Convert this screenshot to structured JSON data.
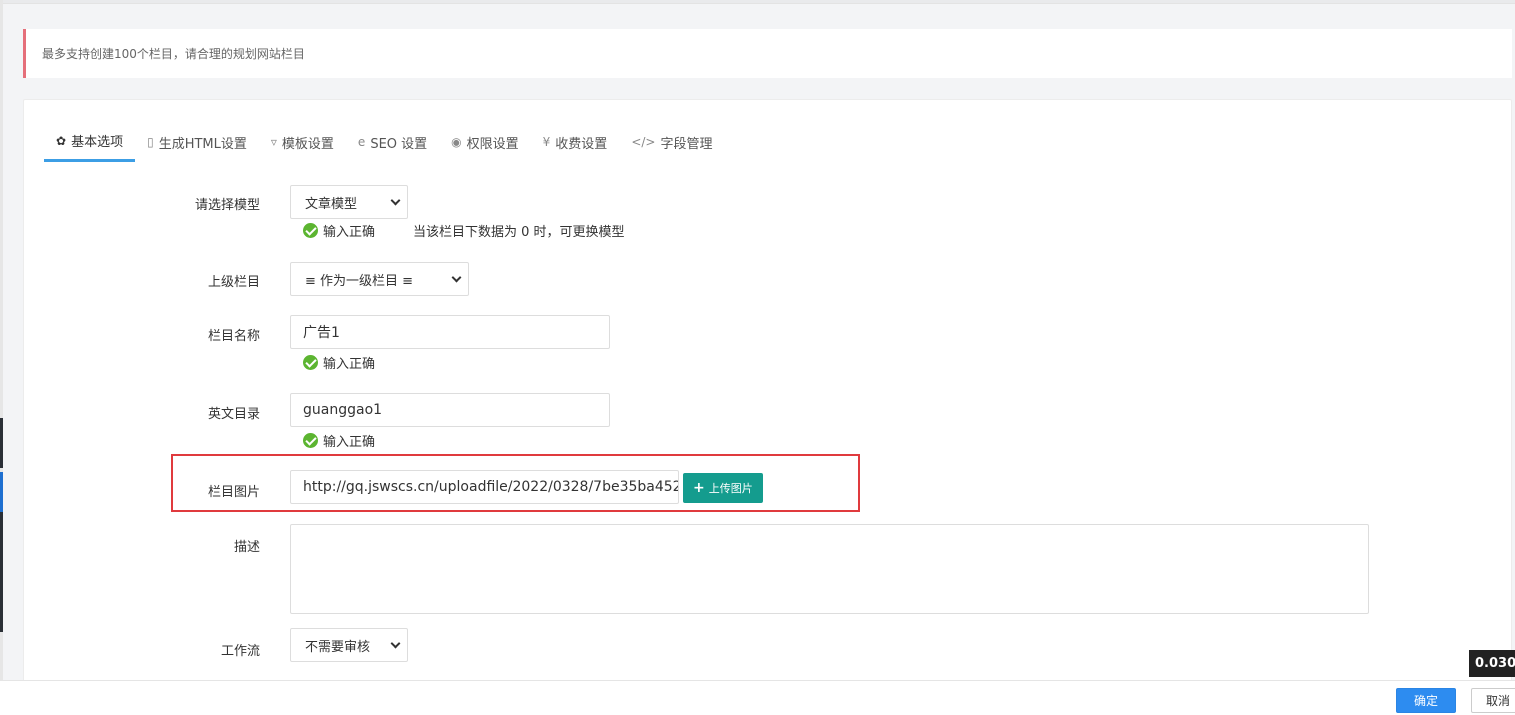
{
  "notice": "最多支持创建100个栏目，请合理的规划网站栏目",
  "tabs": [
    {
      "icon": "gear-icon",
      "glyph": "✿",
      "label": "基本选项"
    },
    {
      "icon": "file-html-icon",
      "glyph": "▯",
      "label": "生成HTML设置"
    },
    {
      "icon": "html5-icon",
      "glyph": "▿",
      "label": "模板设置"
    },
    {
      "icon": "ie-icon",
      "glyph": "e",
      "label": "SEO 设置"
    },
    {
      "icon": "user-circle-icon",
      "glyph": "◉",
      "label": "权限设置"
    },
    {
      "icon": "yen-icon",
      "glyph": "¥",
      "label": "收费设置"
    },
    {
      "icon": "code-icon",
      "glyph": "</>",
      "label": "字段管理"
    }
  ],
  "form": {
    "model": {
      "label": "请选择模型",
      "value": "文章模型",
      "status": "输入正确",
      "hint": "当该栏目下数据为 0 时，可更换模型"
    },
    "parent": {
      "label": "上级栏目",
      "value": "≡ 作为一级栏目 ≡"
    },
    "name": {
      "label": "栏目名称",
      "value": "广告1",
      "status": "输入正确"
    },
    "dir": {
      "label": "英文目录",
      "value": "guanggao1",
      "status": "输入正确"
    },
    "image": {
      "label": "栏目图片",
      "value": "http://gq.jswscs.cn/uploadfile/2022/0328/7be35ba452",
      "button": "上传图片"
    },
    "desc": {
      "label": "描述",
      "value": ""
    },
    "workflow": {
      "label": "工作流",
      "value": "不需要审核"
    }
  },
  "footer": {
    "confirm": "确定",
    "cancel": "取消"
  },
  "timer": "0.030"
}
